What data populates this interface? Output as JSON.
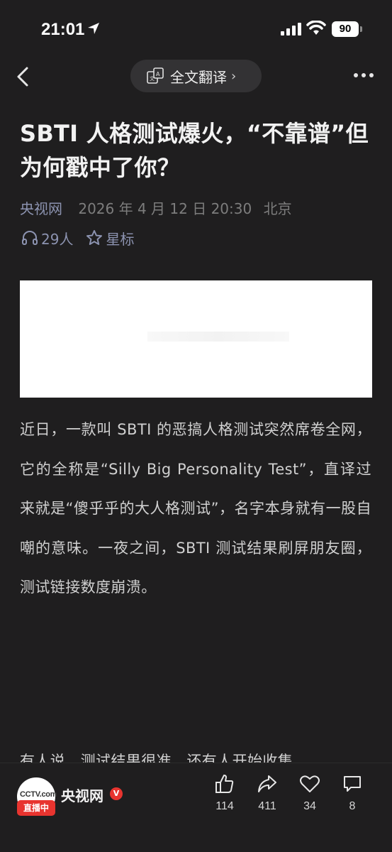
{
  "status_bar": {
    "time": "21:01",
    "battery": "90"
  },
  "nav": {
    "translate_label": "全文翻译",
    "translate_chevron": "›"
  },
  "article": {
    "title": "SBTI 人格测试爆火，“不靠谱”但为何戳中了你？",
    "source": "央视网",
    "date": "2026 年 4 月 12 日 20:30",
    "location": "北京",
    "listeners": "29人",
    "star_label": "星标",
    "paragraph1": "近日，一款叫 SBTI 的恶搞人格测试突然席卷全网，它的全称是“Silly Big Personality Test”，直译过来就是“傻乎乎的大人格测试”，名字本身就有一股自嘲的意味。一夜之间，SBTI 测试结果刷屏朋友圈，测试链接数度崩溃。",
    "paragraph2_partial": "有人说，测试结果很准，还有人开始收集"
  },
  "bottom_bar": {
    "channel_name": "央视网",
    "live_badge": "直播中",
    "logo_text": "CCTV.com",
    "verified_mark": "V",
    "actions": [
      {
        "icon": "thumbs-up-icon",
        "count": "114"
      },
      {
        "icon": "share-icon",
        "count": "411"
      },
      {
        "icon": "heart-icon",
        "count": "34"
      },
      {
        "icon": "comment-icon",
        "count": "8"
      }
    ]
  }
}
